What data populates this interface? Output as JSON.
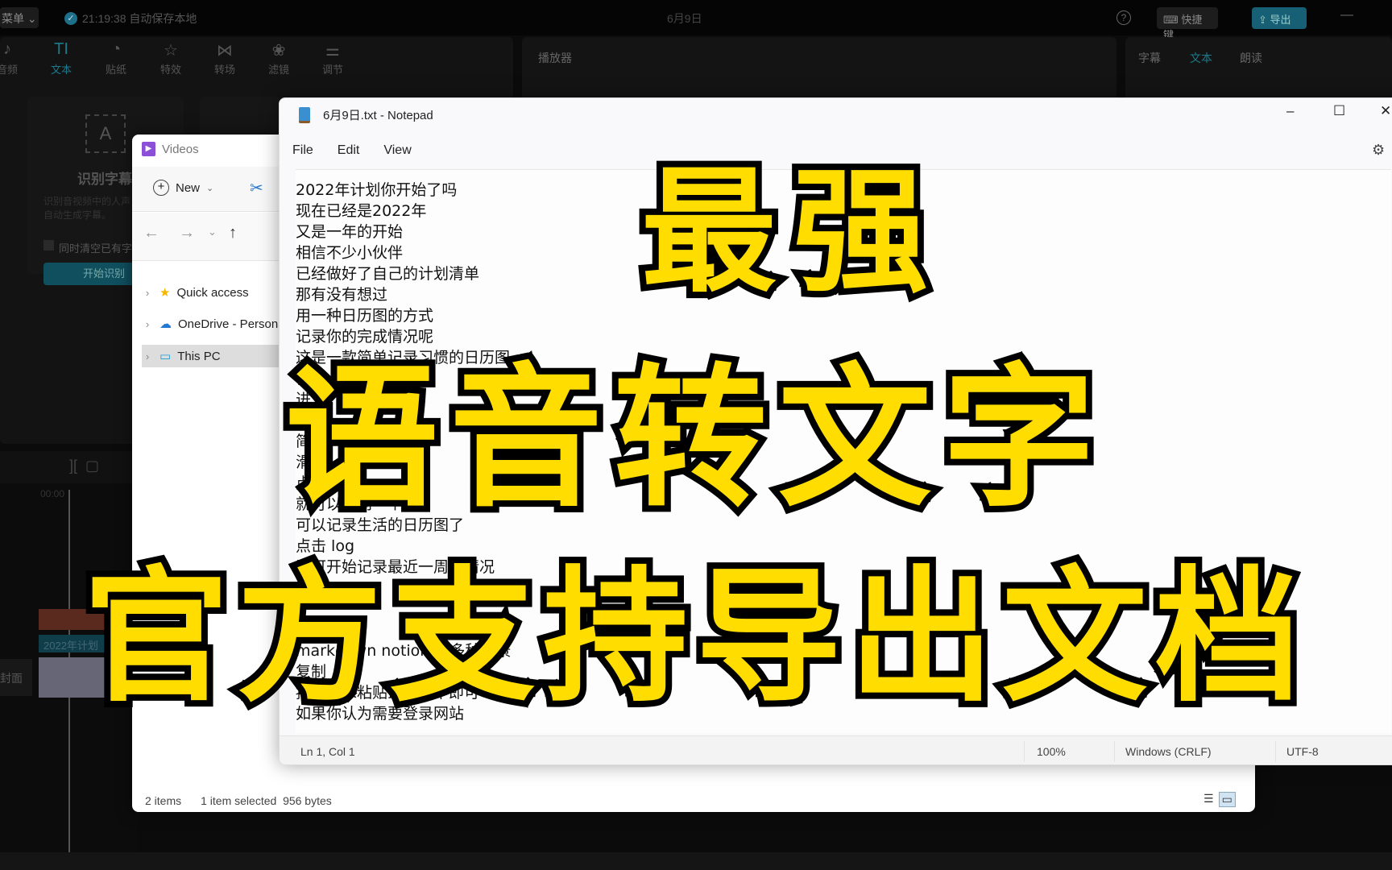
{
  "capcut": {
    "menu_label": "菜单",
    "save_status": "21:19:38 自动保存本地",
    "project_title": "6月9日",
    "shortcut_label": "快捷键",
    "export_label": "导出",
    "tabs": [
      {
        "label": "音频",
        "icon": "music-icon"
      },
      {
        "label": "文本",
        "icon": "text-icon",
        "active": true
      },
      {
        "label": "贴纸",
        "icon": "sticker-icon"
      },
      {
        "label": "特效",
        "icon": "effects-icon"
      },
      {
        "label": "转场",
        "icon": "transition-icon"
      },
      {
        "label": "滤镜",
        "icon": "filter-icon"
      },
      {
        "label": "调节",
        "icon": "adjust-icon"
      }
    ],
    "recognize_card": {
      "title": "识别字幕",
      "desc": "识别音视频中的人声，自动生成字幕。",
      "checkbox_label": "同时清空已有字幕",
      "button": "开始识别"
    },
    "player_title": "播放器",
    "right_tabs": [
      "字幕",
      "文本",
      "朗读"
    ],
    "timeline_time": "00:00",
    "track_clip_text": "2022年计划",
    "cover_label": "封面",
    "accent": "#1d7a8a"
  },
  "explorer": {
    "title": "Videos",
    "new_label": "New",
    "nav": [
      {
        "label": "Quick access",
        "icon": "star-icon"
      },
      {
        "label": "OneDrive - Personal",
        "icon": "cloud-icon"
      },
      {
        "label": "This PC",
        "icon": "computer-icon",
        "selected": true
      }
    ],
    "status_items": "2 items",
    "status_selected": "1 item selected  956 bytes"
  },
  "notepad": {
    "title": "6月9日.txt - Notepad",
    "menu": [
      "File",
      "Edit",
      "View"
    ],
    "lines": [
      "2022年计划你开始了吗",
      "现在已经是2022年",
      "又是一年的开始",
      "相信不少小伙伴",
      "已经做好了自己的计划清单",
      "那有没有想过",
      "用一种日历图的方式",
      "记录你的完成情况呢",
      "这是一款简单记录习惯的日历图",
      "使",
      "进",
      "新",
      "简单",
      "滑动",
      "点击",
      "就可以得到一个",
      "可以记录生活的日历图了",
      "点击 log",
      "即可开始记录最近一周的情况",
      "",
      "",
      "",
      "markdown notion 等多种场景",
      "复制",
      "按照要求粘贴到笔记中即可",
      "如果你认为需要登录网站"
    ],
    "status": {
      "position": "Ln 1, Col 1",
      "zoom": "100%",
      "line_ending": "Windows (CRLF)",
      "encoding": "UTF-8"
    }
  },
  "overlay": {
    "line1": "最强",
    "line2": "语音转文字",
    "line3": "官方支持导出文档",
    "fill_color": "#FFDD00",
    "stroke_color": "#000000"
  }
}
